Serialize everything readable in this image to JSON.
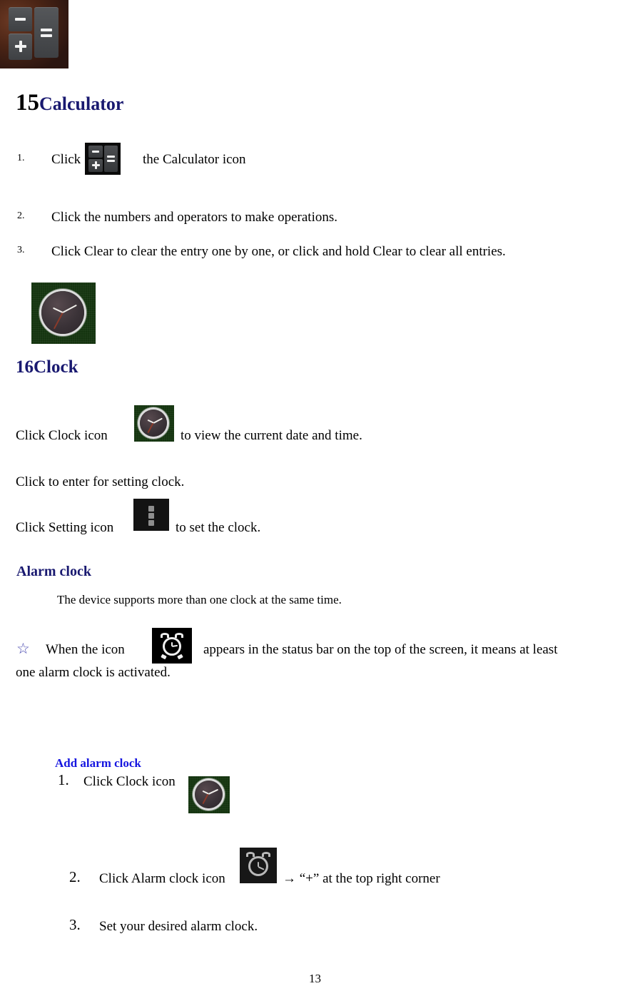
{
  "document": {
    "page_number": "13"
  },
  "banner": {
    "icon_name": "calculator-app-icon"
  },
  "section_calculator": {
    "heading_number": "15",
    "heading_title": "Calculator",
    "steps": [
      {
        "marker": "1.",
        "text_before": "Click",
        "icon": "calculator-icon",
        "text_after": "the Calculator icon"
      },
      {
        "marker": "2.",
        "text": "Click the numbers and operators to make operations."
      },
      {
        "marker": "3.",
        "text": "Click Clear to clear the entry one by one, or click and hold Clear to clear all entries."
      }
    ]
  },
  "section_clock": {
    "tile_icon": "clock-app-icon",
    "heading": "16Clock",
    "line1_before": "Click Clock icon",
    "line1_icon": "clock-icon",
    "line1_after": "to view the current date and time.",
    "line2": "Click to enter for setting clock.",
    "line3_before": "Click Setting icon",
    "line3_icon": "settings-kebab-icon",
    "line3_after": "to set the clock."
  },
  "section_alarm": {
    "heading": "Alarm clock",
    "note": "The device supports more than one clock at the same time.",
    "bullet_symbol": "☆",
    "bullet_before": "When the icon",
    "bullet_icon": "alarm-clock-icon",
    "bullet_after": "appears in the status bar on the top of the screen, it means at least",
    "bullet_line2": "one alarm clock is activated."
  },
  "section_add_alarm": {
    "heading": "Add alarm clock",
    "steps": [
      {
        "marker": "1.",
        "text": "Click Clock icon",
        "icon": "clock-icon"
      },
      {
        "marker": "2.",
        "text_before": "Click Alarm clock icon",
        "icon": "alarm-clock-icon",
        "text_after": "→ “+” at the top right corner"
      },
      {
        "marker": "3.",
        "text": "Set your desired alarm clock."
      }
    ]
  },
  "colors": {
    "heading_navy": "#191970",
    "heading_blue": "#1515E0",
    "body_text": "#000000",
    "clock_tile_bg": "#14340F",
    "alarm_tile_bg": "#000000"
  }
}
